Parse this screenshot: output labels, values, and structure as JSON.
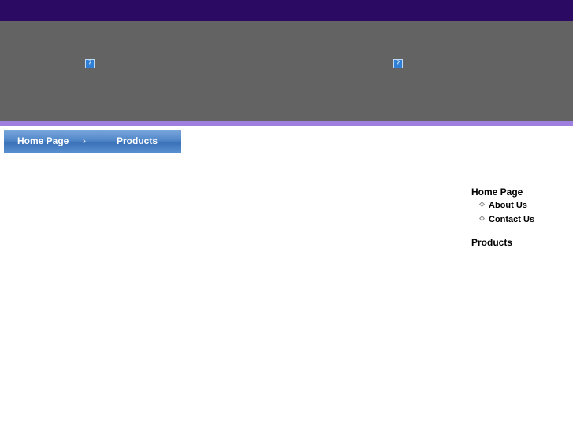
{
  "banner": {
    "image_icon": "broken-image-icon",
    "image_glyph": "?"
  },
  "breadcrumb": {
    "home_label": "Home Page",
    "separator": "›",
    "current_label": "Products"
  },
  "side_nav": {
    "home_label": "Home Page",
    "sub_items": [
      {
        "label": "About Us"
      },
      {
        "label": "Contact Us"
      }
    ],
    "products_label": "Products"
  },
  "colors": {
    "top_bar": "#2a0a63",
    "banner": "#636363",
    "accent_bar": "#9e7fe0",
    "breadcrumb": "#4f86c8"
  }
}
